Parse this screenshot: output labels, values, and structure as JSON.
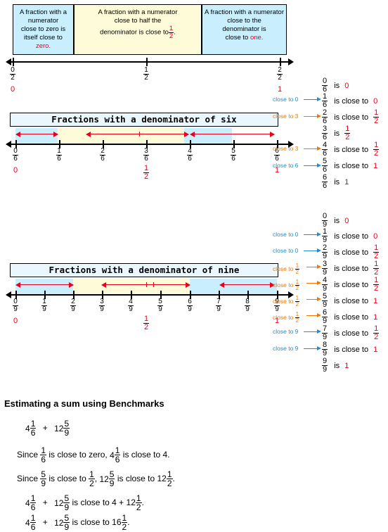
{
  "top_boxes": [
    {
      "lines": [
        "A fraction with a numerator",
        "close to zero is",
        "itself close to",
        "zero."
      ],
      "highlight": "zero."
    },
    {
      "lines": [
        "A fraction with a numerator",
        "close to half the",
        "denominator is close to",
        "1/2."
      ]
    },
    {
      "lines": [
        "A fraction with a numerator",
        "close to the",
        "denominator is",
        "close to one."
      ],
      "highlight": "one."
    }
  ],
  "top_line": {
    "labels": [
      {
        "num": "0",
        "den": "2",
        "under": "0"
      },
      {
        "num": "1",
        "den": "2",
        "under": ""
      },
      {
        "num": "2",
        "den": "2",
        "under": "1"
      }
    ]
  },
  "six": {
    "title": "Fractions with a denominator of six",
    "labels": [
      {
        "num": "0",
        "den": "6",
        "under": "0"
      },
      {
        "num": "1",
        "den": "6",
        "under": ""
      },
      {
        "num": "2",
        "den": "6",
        "under": ""
      },
      {
        "num": "3",
        "den": "6",
        "under": "1/2"
      },
      {
        "num": "4",
        "den": "6",
        "under": ""
      },
      {
        "num": "5",
        "den": "6",
        "under": ""
      },
      {
        "num": "6",
        "den": "6",
        "under": "1"
      }
    ],
    "list": [
      {
        "num": "0",
        "den": "6",
        "verb": "is",
        "value": "0",
        "note": ""
      },
      {
        "num": "1",
        "den": "6",
        "verb": "is close to",
        "value": "0",
        "note": "close to 0",
        "note_color": "#1d8fd1"
      },
      {
        "num": "2",
        "den": "6",
        "verb": "is close to",
        "value": "1/2",
        "note": "close to 3",
        "note_color": "#f07800"
      },
      {
        "num": "3",
        "den": "6",
        "verb": "is",
        "value": "1/2",
        "note": ""
      },
      {
        "num": "4",
        "den": "6",
        "verb": "is close to",
        "value": "1/2",
        "note": "close to 3",
        "note_color": "#f07800"
      },
      {
        "num": "5",
        "den": "6",
        "verb": "is close to",
        "value": "1",
        "note": "close to 6",
        "note_color": "#1d8fd1"
      },
      {
        "num": "6",
        "den": "6",
        "verb": "is",
        "value": "1",
        "note": ""
      }
    ]
  },
  "nine": {
    "title": "Fractions with a denominator of nine",
    "labels": [
      {
        "num": "0",
        "den": "9",
        "under": "0"
      },
      {
        "num": "1",
        "den": "9",
        "under": ""
      },
      {
        "num": "2",
        "den": "9",
        "under": ""
      },
      {
        "num": "3",
        "den": "9",
        "under": ""
      },
      {
        "num": "4",
        "den": "9",
        "under": ""
      },
      {
        "num": "5",
        "den": "9",
        "under": "1/2"
      },
      {
        "num": "6",
        "den": "9",
        "under": ""
      },
      {
        "num": "7",
        "den": "9",
        "under": ""
      },
      {
        "num": "8",
        "den": "9",
        "under": ""
      },
      {
        "num": "9",
        "den": "9",
        "under": "1"
      }
    ],
    "list": [
      {
        "num": "0",
        "den": "9",
        "verb": "is",
        "value": "0",
        "note": ""
      },
      {
        "num": "1",
        "den": "9",
        "verb": "is close to",
        "value": "0",
        "note": "close to 0",
        "note_color": "#1d8fd1"
      },
      {
        "num": "2",
        "den": "9",
        "verb": "is close to",
        "value": "1/2",
        "note": "close to 0",
        "note_color": "#1d8fd1"
      },
      {
        "num": "3",
        "den": "9",
        "verb": "is close to",
        "value": "1/2",
        "note": "close to 1/2",
        "note_color": "#f07800"
      },
      {
        "num": "4",
        "den": "9",
        "verb": "is close to",
        "value": "1/2",
        "note": "close to 1/2",
        "note_color": "#f07800"
      },
      {
        "num": "5",
        "den": "9",
        "verb": "is close to",
        "value": "1",
        "note": "close to 1/2",
        "note_color": "#f07800"
      },
      {
        "num": "6",
        "den": "9",
        "verb": "is close to",
        "value": "1",
        "note": "close to 1/2",
        "note_color": "#f07800"
      },
      {
        "num": "7",
        "den": "9",
        "verb": "is close to",
        "value": "1/2",
        "note": "close to 9",
        "note_color": "#1d8fd1"
      },
      {
        "num": "8",
        "den": "9",
        "verb": "is close to",
        "value": "1",
        "note": "close to 9",
        "note_color": "#1d8fd1"
      },
      {
        "num": "9",
        "den": "9",
        "verb": "is",
        "value": "1",
        "note": ""
      }
    ]
  },
  "bottom": {
    "heading": "Estimating a sum using Benchmarks",
    "expr_a": {
      "w1": "4",
      "n1": "1",
      "d1": "6",
      "plus": "+",
      "w2": "12",
      "n2": "5",
      "d2": "9"
    },
    "line1_pre": "Since ",
    "line1_mid": " is close to zero, ",
    "line1_post": " is close to 4.",
    "line2_pre": "Since ",
    "line2_mid": " is close to ",
    "line2_post": " is close to 12",
    "line3_mid": "  is close to   ",
    "line3_val": "4 + 12",
    "line4_mid": "  is close to   ",
    "line4_val": "16"
  }
}
